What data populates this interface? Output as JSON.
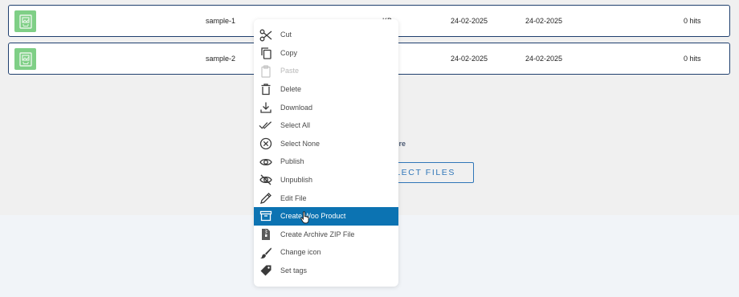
{
  "files": [
    {
      "name": "sample-1",
      "size": "KB",
      "created": "24-02-2025",
      "modified": "24-02-2025",
      "hits": "0 hits"
    },
    {
      "name": "sample-2",
      "size": "KB",
      "created": "24-02-2025",
      "modified": "24-02-2025",
      "hits": "0 hits"
    }
  ],
  "drop_zone": {
    "text": "ent here",
    "button_label": "ELECT FILES"
  },
  "context_menu": {
    "items": [
      {
        "label": "Cut",
        "icon": "scissors-icon",
        "state": "normal"
      },
      {
        "label": "Copy",
        "icon": "copy-icon",
        "state": "normal"
      },
      {
        "label": "Paste",
        "icon": "clipboard-icon",
        "state": "disabled"
      },
      {
        "label": "Delete",
        "icon": "trash-icon",
        "state": "normal"
      },
      {
        "label": "Download",
        "icon": "download-icon",
        "state": "normal"
      },
      {
        "label": "Select All",
        "icon": "double-check-icon",
        "state": "normal"
      },
      {
        "label": "Select None",
        "icon": "circle-x-icon",
        "state": "normal"
      },
      {
        "label": "Publish",
        "icon": "eye-icon",
        "state": "normal"
      },
      {
        "label": "Unpublish",
        "icon": "eye-off-icon",
        "state": "normal"
      },
      {
        "label": "Edit File",
        "icon": "pencil-icon",
        "state": "normal"
      },
      {
        "label": "Create Woo Product",
        "icon": "archive-box-icon",
        "state": "highlighted"
      },
      {
        "label": "Create Archive ZIP File",
        "icon": "zip-file-icon",
        "state": "normal"
      },
      {
        "label": "Change icon",
        "icon": "brush-icon",
        "state": "normal"
      },
      {
        "label": "Set tags",
        "icon": "tag-icon",
        "state": "normal"
      }
    ]
  },
  "colors": {
    "highlight": "#0c73b2",
    "row_border": "#1f3f6e",
    "thumb": "#7fcf86",
    "button_accent": "#2f76b8"
  }
}
